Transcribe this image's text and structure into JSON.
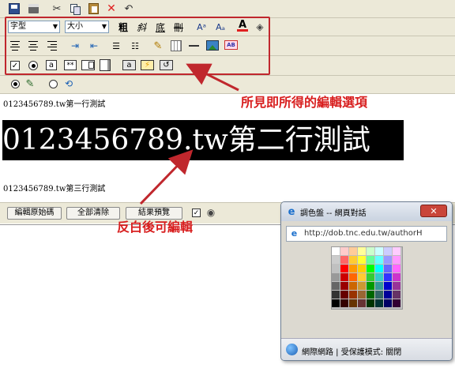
{
  "toolbar_top": {
    "icons": [
      "save-icon",
      "print-icon",
      "cut-icon",
      "copy-icon",
      "paste-icon",
      "delete-icon",
      "undo-icon"
    ]
  },
  "format_bar": {
    "font_select": {
      "value": "字型"
    },
    "size_select": {
      "value": "大小"
    },
    "bold_glyph": "粗",
    "italic_glyph": "斜",
    "underline_glyph": "底",
    "strike_glyph": "刪",
    "superscript_glyph": "Aᵃ",
    "subscript_glyph": "Aₐ",
    "forecolor_glyph": "A"
  },
  "form_bar": {
    "text_field_glyph": "a",
    "password_glyph": "**",
    "button_glyph": "a"
  },
  "mode_bar": {
    "modes": [
      "design-mode-icon",
      "html-mode-icon"
    ]
  },
  "editor": {
    "line1": "0123456789.tw第一行測試",
    "line2": "0123456789.tw第二行測試",
    "line3": "0123456789.tw第三行測試"
  },
  "bottom_bar": {
    "source_button": "編輯原始碼",
    "clear_button": "全部清除",
    "preview_button": "結果預覽"
  },
  "annotations": {
    "options_note": "所見即所得的編輯選項",
    "edit_note": "反白後可編輯"
  },
  "palette_dialog": {
    "title": "調色盤 -- 網頁對話",
    "url": "http://dob.tnc.edu.tw/authorH",
    "status": "網際網路 | 受保護模式: 關閉"
  },
  "palette_colors": [
    [
      "#ffffff",
      "#ffcccc",
      "#ffcc99",
      "#ffff99",
      "#ccffcc",
      "#ccffff",
      "#ccccff",
      "#ffccff"
    ],
    [
      "#cccccc",
      "#ff6666",
      "#ffcc33",
      "#ffff33",
      "#66ff99",
      "#66ffff",
      "#9999ff",
      "#ff99ff"
    ],
    [
      "#c0c0c0",
      "#ff0000",
      "#ff9900",
      "#ffcc00",
      "#00ff00",
      "#00ffff",
      "#6666ff",
      "#ff66ff"
    ],
    [
      "#999999",
      "#cc0000",
      "#ff6600",
      "#ffcc33",
      "#33cc33",
      "#33cccc",
      "#3333ff",
      "#cc33cc"
    ],
    [
      "#666666",
      "#990000",
      "#cc6600",
      "#cc9933",
      "#009900",
      "#339999",
      "#0000cc",
      "#993399"
    ],
    [
      "#333333",
      "#660000",
      "#993300",
      "#996633",
      "#006600",
      "#336666",
      "#000099",
      "#663366"
    ],
    [
      "#000000",
      "#330000",
      "#663300",
      "#663333",
      "#003300",
      "#003333",
      "#000066",
      "#330033"
    ]
  ],
  "colors": {
    "accent_red": "#d81e1e",
    "toolbar_bg": "#ece9d8"
  }
}
